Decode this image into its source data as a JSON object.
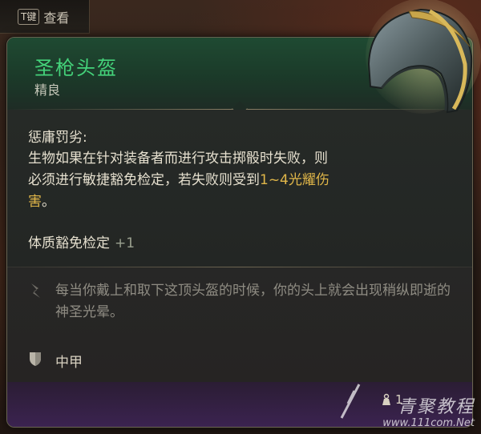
{
  "key_hint": {
    "key": "T键",
    "label": "查看"
  },
  "item": {
    "name": "圣枪头盔",
    "rarity": "精良",
    "passive_title": "惩庸罚劣:",
    "passive_desc_part1": "生物如果在针对装备者而进行攻击掷骰时失败，则必须进行敏捷豁免检定，若失败则受到",
    "passive_desc_highlight": "1~4光耀伤害",
    "passive_desc_part2": "。",
    "bonus_label": "体质豁免检定",
    "bonus_value": "+1",
    "lore": "每当你戴上和取下这顶头盔的时候，你的头上就会出现稍纵即逝的神圣光晕。",
    "armor_type": "中甲",
    "weight": "1"
  },
  "watermark": {
    "title": "青聚教程",
    "url": "www.111com.Net"
  },
  "icons": {
    "quill": "quill-icon",
    "armor": "shield-icon",
    "weight": "weight-icon",
    "helmet": "helmet-icon"
  },
  "colors": {
    "name": "#44d27a",
    "highlight": "#e0b649",
    "header": "#1f4a32",
    "footer": "#3b2350"
  }
}
